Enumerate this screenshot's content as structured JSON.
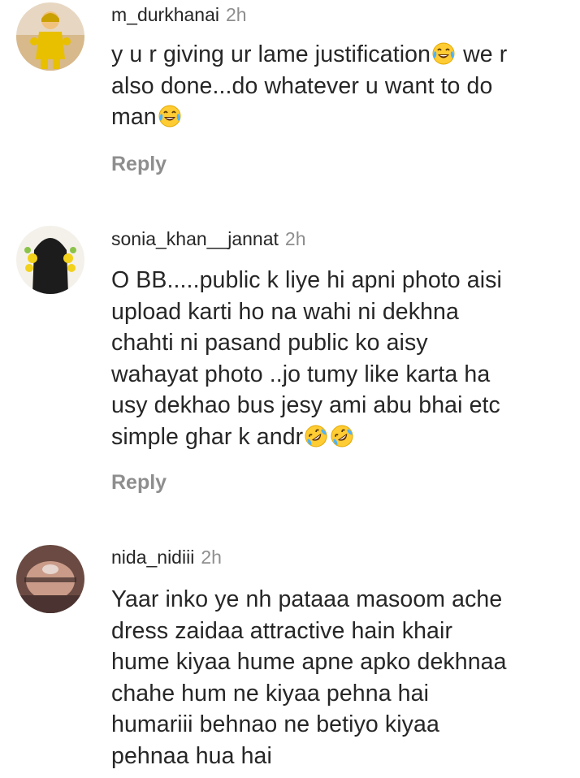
{
  "comments": [
    {
      "username": "m_durkhanai",
      "time": "2h",
      "lines": [
        [
          "y u r giving ur lame justification",
          "joy-emoji",
          " we r"
        ],
        [
          "also done...do whatever u want to do"
        ],
        [
          "man",
          "joy-emoji"
        ]
      ],
      "reply_label": "Reply"
    },
    {
      "username": "sonia_khan__jannat",
      "time": "2h",
      "lines": [
        [
          "O BB.....public k liye hi apni photo aisi"
        ],
        [
          "upload karti ho na wahi ni dekhna"
        ],
        [
          "chahti ni pasand public ko aisy"
        ],
        [
          "wahayat photo ..jo tumy like karta ha"
        ],
        [
          "usy dekhao bus jesy ami abu bhai etc"
        ],
        [
          "simple ghar k andr",
          "rofl-emoji",
          "rofl-emoji"
        ]
      ],
      "reply_label": "Reply"
    },
    {
      "username": "nida_nidiii",
      "time": "2h",
      "lines": [
        [
          "Yaar inko ye nh pataaa masoom ache"
        ],
        [
          "dress zaidaa attractive hain  khair"
        ],
        [
          "hume kiyaa hume apne apko dekhnaa"
        ],
        [
          "chahe hum ne kiyaa pehna hai"
        ],
        [
          "humariii behnao ne betiyo kiyaa"
        ],
        [
          "pehnaa hua hai"
        ]
      ]
    }
  ],
  "colors": {
    "text": "#262626",
    "secondary": "#8e8e8e",
    "emoji_face": "#ffcc33",
    "emoji_tears": "#4fb3ff"
  }
}
